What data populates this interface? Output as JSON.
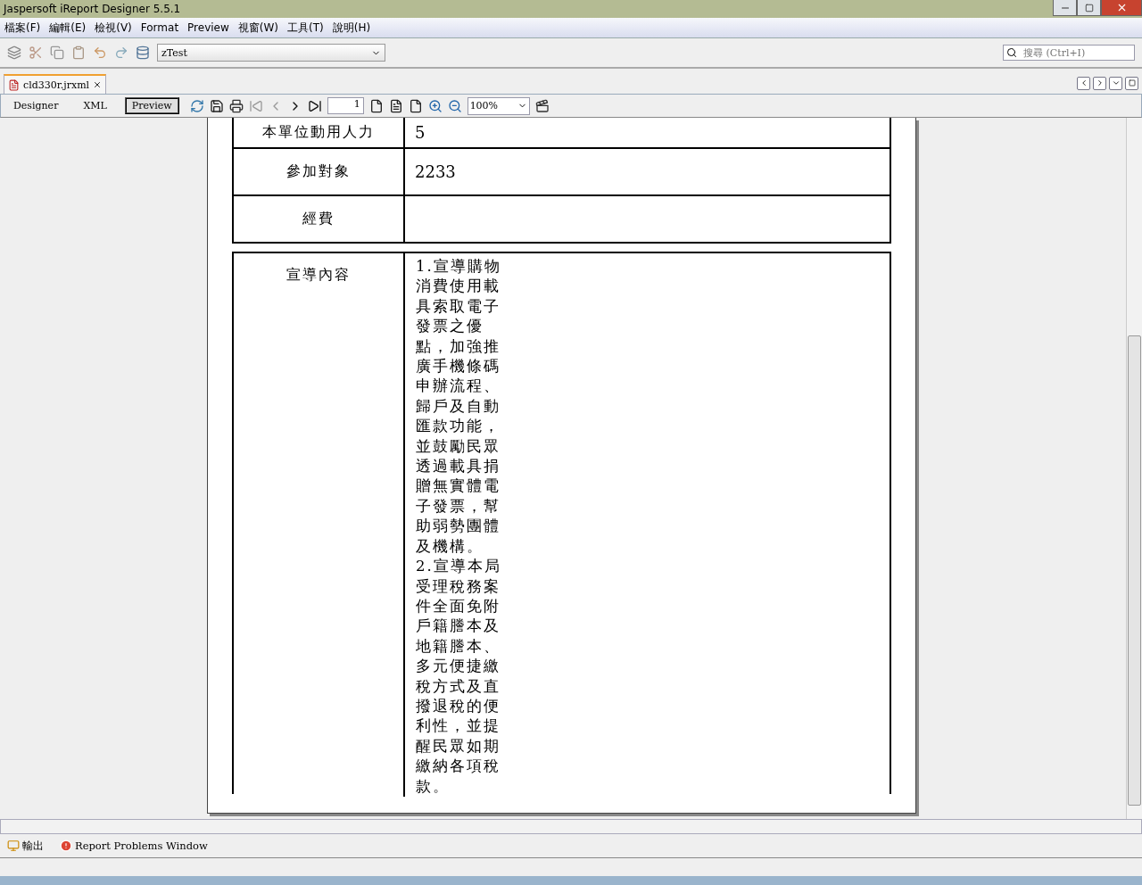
{
  "window": {
    "title": "Jaspersoft iReport Designer 5.5.1"
  },
  "menu": [
    "檔案(F)",
    "編輯(E)",
    "檢視(V)",
    "Format",
    "Preview",
    "視窗(W)",
    "工具(T)",
    "說明(H)"
  ],
  "toolbar": {
    "datasource": "zTest",
    "search": {
      "placeholder": "搜尋 (Ctrl+I)"
    }
  },
  "editor_tabs": [
    {
      "label": "cld330r.jrxml",
      "selected": true
    }
  ],
  "view_tabs": [
    {
      "label": "Designer",
      "selected": false
    },
    {
      "label": "XML",
      "selected": false
    },
    {
      "label": "Preview",
      "selected": true
    }
  ],
  "preview_toolbar": {
    "page": "1",
    "zoom": "100%"
  },
  "report": {
    "rows": [
      {
        "label": "本單位動用人力",
        "value": "5"
      },
      {
        "label": "參加對象",
        "value": "2233"
      },
      {
        "label": "經費",
        "value": ""
      }
    ],
    "content": {
      "label": "宣導內容",
      "lines": [
        "1.宣導購物",
        "消費使用載",
        "具索取電子",
        "發票之優",
        "點，加強推",
        "廣手機條碼",
        "申辦流程、",
        "歸戶及自動",
        "匯款功能，",
        "並鼓勵民眾",
        "透過載具捐",
        "贈無實體電",
        "子發票，幫",
        "助弱勢團體",
        "及機構。",
        "2.宣導本局",
        "受理稅務案",
        "件全面免附",
        "戶籍謄本及",
        "地籍謄本、",
        "多元便捷繳",
        "稅方式及直",
        "撥退稅的便",
        "利性，並提",
        "醒民眾如期",
        "繳納各項稅",
        "款。"
      ]
    }
  },
  "bottom_tabs": [
    {
      "label": "輸出",
      "kind": "output"
    },
    {
      "label": "Report Problems Window",
      "kind": "problems"
    }
  ]
}
